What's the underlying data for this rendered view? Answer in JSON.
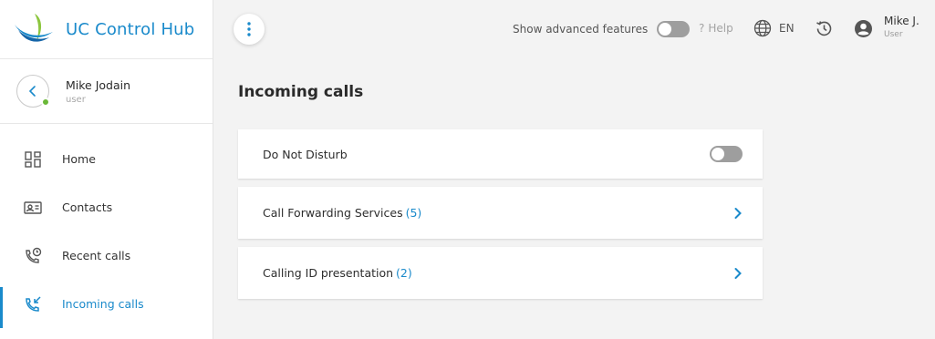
{
  "app": {
    "title": "UC Control Hub",
    "accent": "#1a8acb"
  },
  "user": {
    "name": "Mike Jodain",
    "role": "user",
    "status_color": "#6ab838"
  },
  "sidebar": {
    "items": [
      {
        "label": "Home",
        "icon": "dashboard-icon"
      },
      {
        "label": "Contacts",
        "icon": "contact-card-icon"
      },
      {
        "label": "Recent calls",
        "icon": "phone-clock-icon"
      },
      {
        "label": "Incoming calls",
        "icon": "phone-incoming-icon",
        "active": true
      }
    ]
  },
  "header": {
    "advanced_label": "Show advanced features",
    "advanced_enabled": false,
    "help_label": "Help",
    "help_glyph": "?",
    "language": "EN",
    "account_name": "Mike J.",
    "account_role": "User"
  },
  "main": {
    "title": "Incoming calls",
    "cards": [
      {
        "label": "Do Not Disturb",
        "type": "toggle",
        "enabled": false
      },
      {
        "label": "Call Forwarding Services",
        "count": "(5)",
        "type": "link"
      },
      {
        "label": "Calling ID presentation",
        "count": "(2)",
        "type": "link"
      }
    ]
  }
}
